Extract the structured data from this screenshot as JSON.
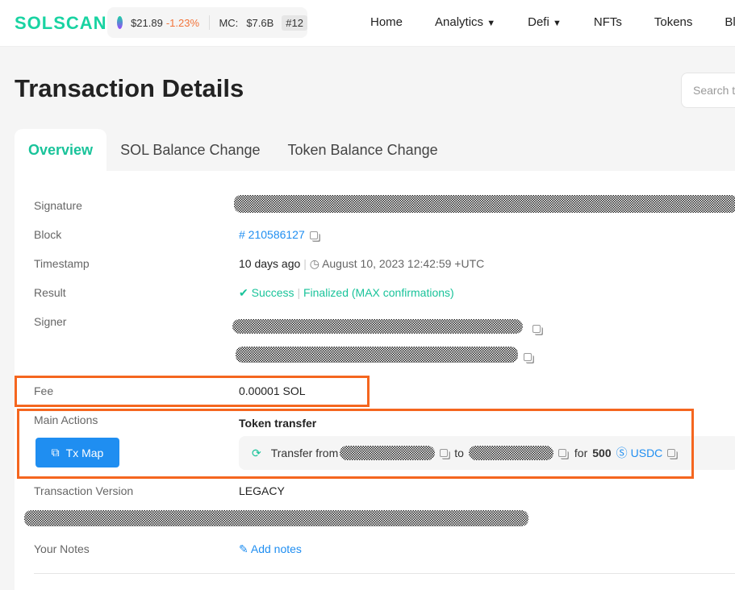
{
  "header": {
    "logo": "SOLSCAN",
    "price": "$21.89",
    "change": "-1.23%",
    "mc_label": "MC:",
    "mc_value": "$7.6B",
    "rank": "#12",
    "nav": [
      "Home",
      "Analytics",
      "Defi",
      "NFTs",
      "Tokens",
      "Blo"
    ]
  },
  "page": {
    "title": "Transaction Details",
    "search_placeholder": "Search t"
  },
  "tabs": [
    "Overview",
    "SOL Balance Change",
    "Token Balance Change"
  ],
  "details": {
    "signature_label": "Signature",
    "block_label": "Block",
    "block": "# 210586127",
    "timestamp_label": "Timestamp",
    "timestamp_relative": "10 days ago",
    "timestamp": "August 10, 2023 12:42:59 +UTC",
    "result_label": "Result",
    "result": "Success",
    "confirmation": "Finalized (MAX confirmations)",
    "signer_label": "Signer",
    "fee_label": "Fee",
    "fee": "0.00001 SOL",
    "main_actions_label": "Main Actions",
    "tx_map": "Tx Map",
    "action_title": "Token transfer",
    "transfer_from": "Transfer from",
    "to": "to",
    "for": "for",
    "amount": "500",
    "token": "USDC",
    "version_label": "Transaction Version",
    "version": "LEGACY",
    "notes_label": "Your Notes",
    "add_notes": "Add notes"
  },
  "colors": {
    "accent": "#19c39a",
    "link": "#1f8ef1",
    "highlight": "#f5661f"
  }
}
